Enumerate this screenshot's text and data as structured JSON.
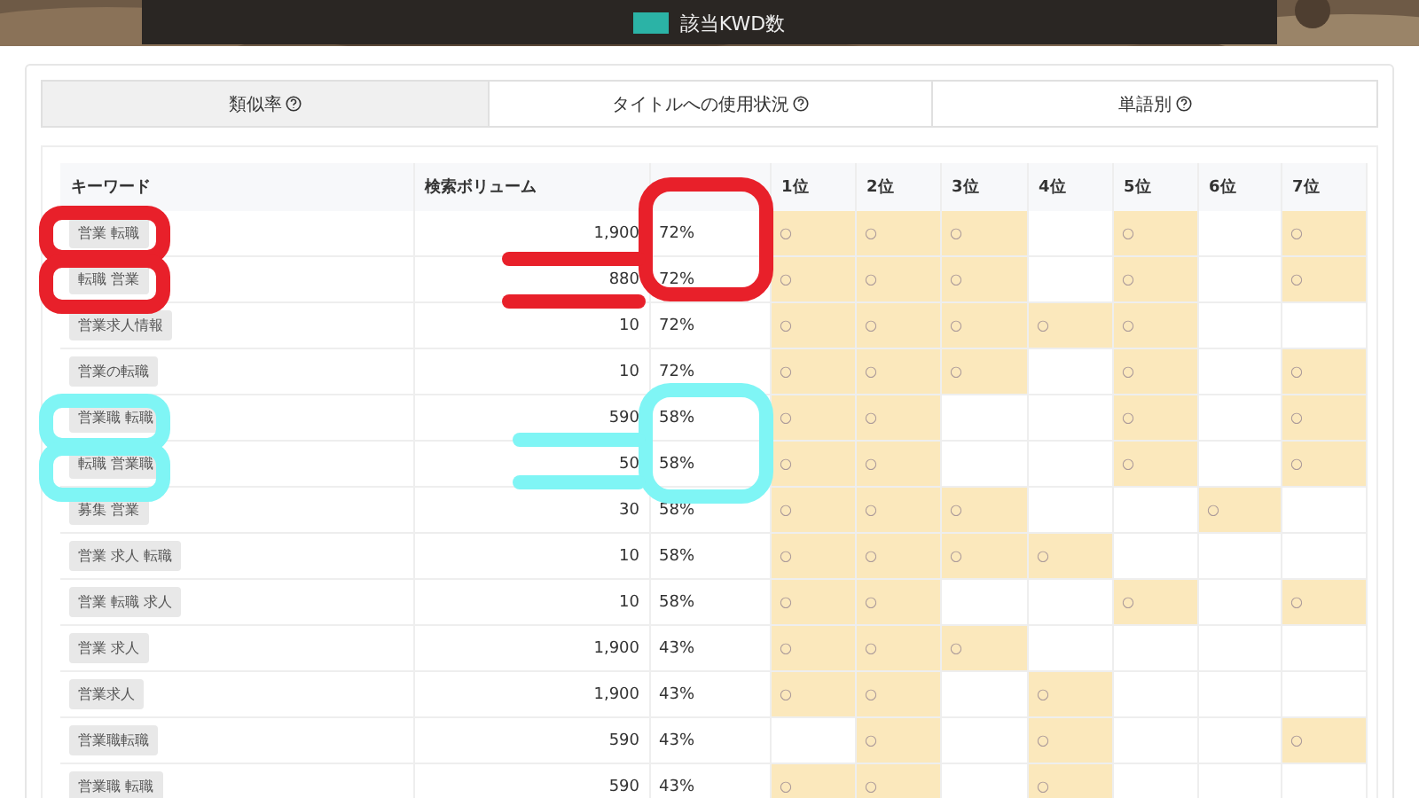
{
  "banner": {
    "kind": "picture",
    "legend_label": "該当KWD数"
  },
  "tabs": [
    {
      "label": "類似率",
      "selected": true
    },
    {
      "label": "タイトルへの使用状況",
      "selected": false
    },
    {
      "label": "単語別",
      "selected": false
    }
  ],
  "table": {
    "columns": [
      "キーワード",
      "検索ボリューム",
      "",
      "1位",
      "2位",
      "3位",
      "4位",
      "5位",
      "6位",
      "7位"
    ],
    "mark": "○",
    "rows": [
      {
        "keyword": "営業 転職",
        "volume": "1,900",
        "rate": "72%",
        "ranks": [
          true,
          true,
          true,
          false,
          true,
          false,
          true
        ]
      },
      {
        "keyword": "転職 営業",
        "volume": "880",
        "rate": "72%",
        "ranks": [
          true,
          true,
          true,
          false,
          true,
          false,
          true
        ]
      },
      {
        "keyword": "営業求人情報",
        "volume": "10",
        "rate": "72%",
        "ranks": [
          true,
          true,
          true,
          true,
          true,
          false,
          false
        ]
      },
      {
        "keyword": "営業の転職",
        "volume": "10",
        "rate": "72%",
        "ranks": [
          true,
          true,
          true,
          false,
          true,
          false,
          true
        ]
      },
      {
        "keyword": "営業職 転職",
        "volume": "590",
        "rate": "58%",
        "ranks": [
          true,
          true,
          false,
          false,
          true,
          false,
          true
        ]
      },
      {
        "keyword": "転職 営業職",
        "volume": "50",
        "rate": "58%",
        "ranks": [
          true,
          true,
          false,
          false,
          true,
          false,
          true
        ]
      },
      {
        "keyword": "募集 営業",
        "volume": "30",
        "rate": "58%",
        "ranks": [
          true,
          true,
          true,
          false,
          false,
          true,
          false
        ]
      },
      {
        "keyword": "営業 求人 転職",
        "volume": "10",
        "rate": "58%",
        "ranks": [
          true,
          true,
          true,
          true,
          false,
          false,
          false
        ]
      },
      {
        "keyword": "営業 転職 求人",
        "volume": "10",
        "rate": "58%",
        "ranks": [
          true,
          true,
          false,
          false,
          true,
          false,
          true
        ]
      },
      {
        "keyword": "営業 求人",
        "volume": "1,900",
        "rate": "43%",
        "ranks": [
          true,
          true,
          true,
          false,
          false,
          false,
          false
        ]
      },
      {
        "keyword": "営業求人",
        "volume": "1,900",
        "rate": "43%",
        "ranks": [
          true,
          true,
          false,
          true,
          false,
          false,
          false
        ]
      },
      {
        "keyword": "営業職転職",
        "volume": "590",
        "rate": "43%",
        "ranks": [
          false,
          true,
          false,
          true,
          false,
          false,
          true
        ]
      },
      {
        "keyword": "営業職 転職",
        "volume": "590",
        "rate": "43%",
        "ranks": [
          true,
          true,
          false,
          true,
          false,
          false,
          false
        ]
      }
    ]
  }
}
